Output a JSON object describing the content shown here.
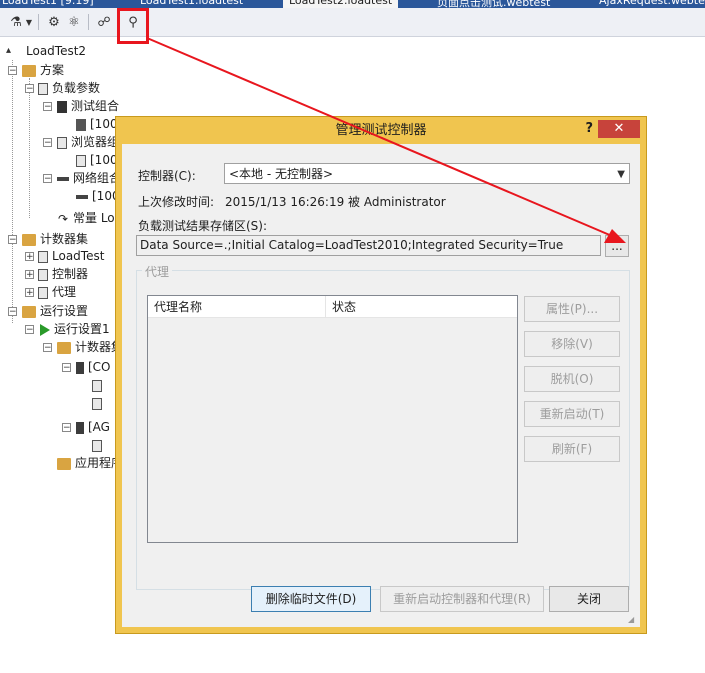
{
  "tabs": [
    {
      "label": "LoadTest1 [9.19]"
    },
    {
      "label": "LoadTest1.loadtest"
    },
    {
      "label": "LoadTest2.loadtest"
    },
    {
      "label": "页面点击测试.webtest"
    },
    {
      "label": "AjaxRequest.webtest"
    }
  ],
  "tree": {
    "root": "LoadTest2",
    "scenario": "方案",
    "load_params": "负载参数",
    "test_mix": "测试组合",
    "test_mix_item": "[100",
    "browser_mix": "浏览器组",
    "browser_mix_item": "[100",
    "network_mix": "网络组合",
    "network_mix_item": "[100",
    "constant_load": "常量 Lo",
    "counter_sets": "计数器集",
    "cs_loadtest": "LoadTest",
    "cs_controller": "控制器",
    "cs_agent": "代理",
    "run_settings": "运行设置",
    "run_settings1": "运行设置1",
    "counter_set_map": "计数器集",
    "computer1": "[CO",
    "computer2": "[AG",
    "app": "应用程序"
  },
  "dialog": {
    "title": "管理测试控制器",
    "help": "?",
    "close": "✕",
    "controller_label": "控制器(C):",
    "controller_value": "<本地 - 无控制器>",
    "modified_label": "上次修改时间:",
    "modified_value": "2015/1/13 16:26:19 被 Administrator",
    "storage_label": "负载测试结果存储区(S):",
    "storage_value": "Data Source=.;Initial Catalog=LoadTest2010;Integrated Security=True",
    "browse": "...",
    "agents_group": "代理",
    "col_agent_name": "代理名称",
    "col_status": "状态",
    "btn_properties": "属性(P)...",
    "btn_remove": "移除(V)",
    "btn_offline": "脱机(O)",
    "btn_restart": "重新启动(T)",
    "btn_refresh": "刷新(F)",
    "btn_delete_temp": "删除临时文件(D)",
    "btn_restart_all": "重新启动控制器和代理(R)",
    "btn_close": "关闭"
  },
  "colors": {
    "highlight": "#e8161e",
    "dialog_frame": "#f0c54f",
    "close_button": "#c7433b"
  }
}
